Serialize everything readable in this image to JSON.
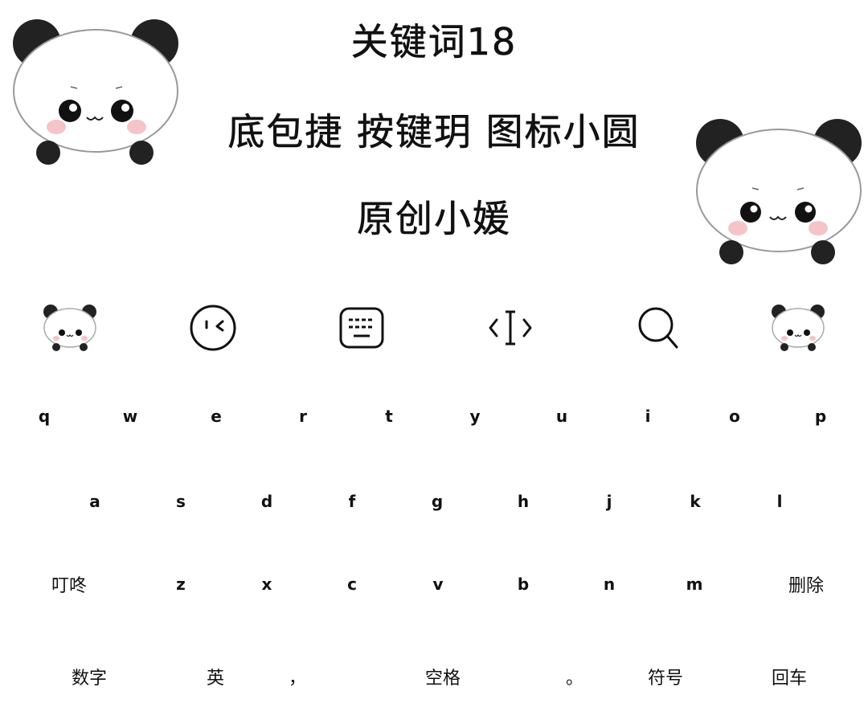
{
  "header": {
    "line1": "关键词18",
    "line2": "底包捷 按键玥 图标小圆",
    "line3": "原创小媛"
  },
  "toolbar": {
    "items": [
      {
        "icon": "panda-icon"
      },
      {
        "icon": "wink-face-icon"
      },
      {
        "icon": "keyboard-icon"
      },
      {
        "icon": "text-cursor-icon"
      },
      {
        "icon": "search-icon"
      },
      {
        "icon": "panda-icon"
      }
    ]
  },
  "keyboard": {
    "row1": [
      "q",
      "w",
      "e",
      "r",
      "t",
      "y",
      "u",
      "i",
      "o",
      "p"
    ],
    "row2": [
      "a",
      "s",
      "d",
      "f",
      "g",
      "h",
      "j",
      "k",
      "l"
    ],
    "row3": [
      "叮咚",
      "z",
      "x",
      "c",
      "v",
      "b",
      "n",
      "m",
      "删除"
    ],
    "row4": [
      "数字",
      "英",
      "，",
      "空格",
      "。",
      "符号",
      "回车"
    ]
  },
  "colors": {
    "background": "#ffffff",
    "ink": "#111111",
    "panda_black": "#222222",
    "blush": "#f4c4c8"
  }
}
